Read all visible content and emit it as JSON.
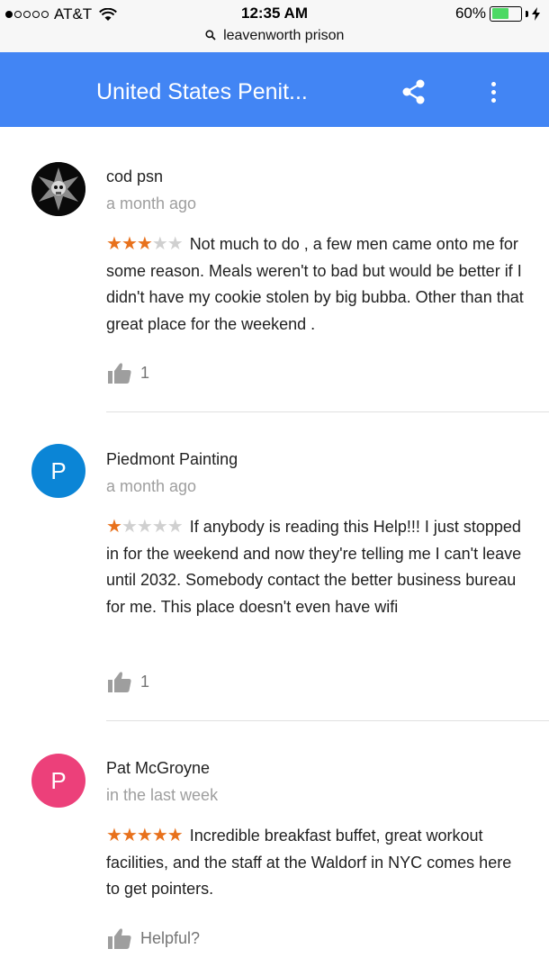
{
  "status": {
    "carrier": "AT&T",
    "time": "12:35 AM",
    "battery": "60%",
    "battery_level": 0.6,
    "url": "leavenworth prison"
  },
  "header": {
    "title": "United States Penit..."
  },
  "reviews": [
    {
      "author": "cod psn",
      "time": "a month ago",
      "rating": 3,
      "text": "Not much to do , a few men came onto me for some reason. Meals weren't to bad but would be better if I didn't have my cookie stolen by big bubba. Other than that great place for the weekend .",
      "likes": "1"
    },
    {
      "author": "Piedmont Painting",
      "avatar_letter": "P",
      "avatar_color": "#0b85d6",
      "time": "a month ago",
      "rating": 1,
      "text": "If anybody is reading this Help!!! I just stopped in for the weekend and now they're telling me I can't leave until 2032. Somebody contact the better business bureau for me. This place doesn't even have wifi",
      "likes": "1"
    },
    {
      "author": "Pat McGroyne",
      "avatar_letter": "P",
      "avatar_color": "#ec407a",
      "time": "in the last week",
      "rating": 5,
      "text": "Incredible breakfast buffet, great workout facilities, and the staff at the Waldorf in NYC comes here to get pointers.",
      "likes": "Helpful?"
    }
  ]
}
